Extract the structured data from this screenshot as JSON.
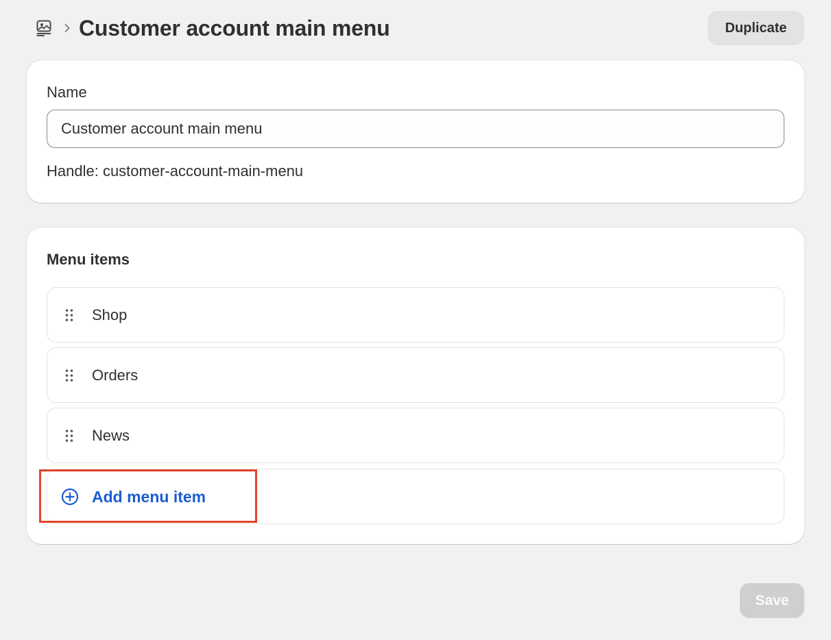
{
  "header": {
    "nav_icon": "online-store-icon",
    "breadcrumb_separator_icon": "chevron-right-icon",
    "title": "Customer account main menu",
    "duplicate_label": "Duplicate"
  },
  "name_card": {
    "label": "Name",
    "input_value": "Customer account main menu",
    "handle_text": "Handle: customer-account-main-menu"
  },
  "menu_card": {
    "title": "Menu items",
    "items": [
      {
        "label": "Shop"
      },
      {
        "label": "Orders"
      },
      {
        "label": "News"
      }
    ],
    "add_label": "Add menu item",
    "add_icon": "plus-circle-icon",
    "highlight_color": "#e1432b"
  },
  "footer": {
    "save_label": "Save",
    "save_disabled": true
  },
  "colors": {
    "background": "#f1f1f1",
    "card": "#ffffff",
    "link": "#1a5dd1",
    "highlight": "#e1432b"
  }
}
